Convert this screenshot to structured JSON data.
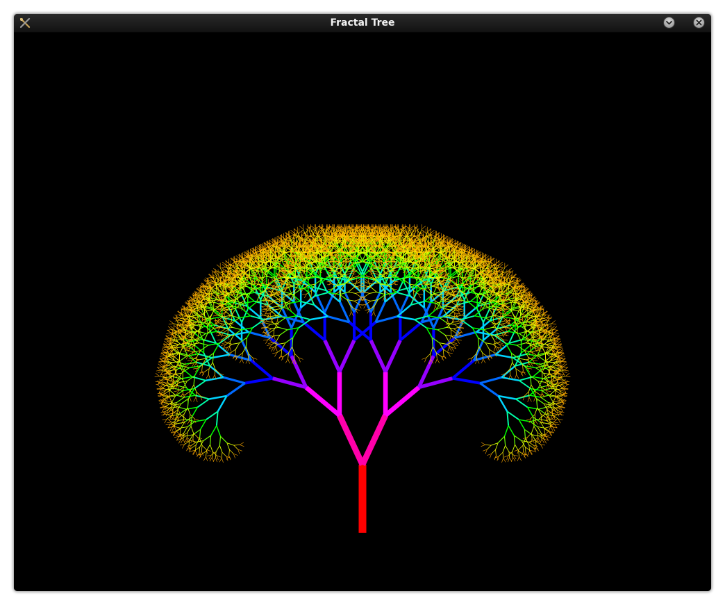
{
  "window": {
    "title": "Fractal Tree",
    "app_icon": "x-tools-icon",
    "buttons": [
      {
        "name": "minimize",
        "icon": "chevron-down-icon"
      },
      {
        "name": "close",
        "icon": "close-icon"
      }
    ]
  },
  "fractal": {
    "depth": 12,
    "branch_angle_deg": 25,
    "length_ratio": 0.8,
    "color_order": "hue-spectrum",
    "background": "#000000",
    "trunk_color": "#ff0000"
  }
}
